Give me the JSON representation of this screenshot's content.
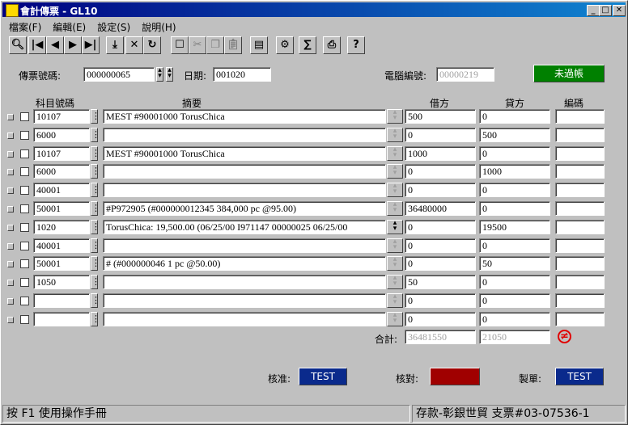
{
  "window": {
    "title": "會計傳票 - GL10"
  },
  "menu": [
    "檔案(F)",
    "編輯(E)",
    "設定(S)",
    "說明(H)"
  ],
  "toolbar": [
    {
      "icon": "search-icon",
      "glyph": "🔍︎"
    },
    {
      "icon": "first-record-icon",
      "glyph": "|◀"
    },
    {
      "icon": "prev-record-icon",
      "glyph": "◀"
    },
    {
      "icon": "next-record-icon",
      "glyph": "▶"
    },
    {
      "icon": "last-record-icon",
      "glyph": "▶|"
    },
    {
      "icon": "save-icon",
      "glyph": "⤓"
    },
    {
      "icon": "delete-icon",
      "glyph": "✕"
    },
    {
      "icon": "refresh-icon",
      "glyph": "↻"
    },
    {
      "icon": "new-icon",
      "glyph": "☐"
    },
    {
      "icon": "cut-icon",
      "glyph": "✂"
    },
    {
      "icon": "copy-icon",
      "glyph": "❐"
    },
    {
      "icon": "paste-icon",
      "glyph": "📋︎"
    },
    {
      "icon": "report-icon",
      "glyph": "▤"
    },
    {
      "icon": "options-icon",
      "glyph": "⚙"
    },
    {
      "icon": "calc-icon",
      "glyph": "∑"
    },
    {
      "icon": "print-icon",
      "glyph": "⎙"
    },
    {
      "icon": "help-icon",
      "glyph": "?"
    }
  ],
  "header": {
    "voucher_label": "傳票號碼:",
    "voucher_value": "000000065",
    "date_label": "日期:",
    "date_value": "001020",
    "computer_no_label": "電腦編號:",
    "computer_no_value": "00000219",
    "post_button": "未過帳"
  },
  "columns": {
    "account": "科目號碼",
    "summary": "摘要",
    "debit": "借方",
    "credit": "貸方",
    "code": "編碼"
  },
  "rows": [
    {
      "account": "10107",
      "summary": "MEST #90001000 TorusChica",
      "debit": "500",
      "credit": "0",
      "code": ""
    },
    {
      "account": "6000",
      "summary": "",
      "debit": "0",
      "credit": "500",
      "code": ""
    },
    {
      "account": "10107",
      "summary": "MEST #90001000 TorusChica",
      "debit": "1000",
      "credit": "0",
      "code": ""
    },
    {
      "account": "6000",
      "summary": "",
      "debit": "0",
      "credit": "1000",
      "code": ""
    },
    {
      "account": "40001",
      "summary": "",
      "debit": "0",
      "credit": "0",
      "code": ""
    },
    {
      "account": "50001",
      "summary": "#P972905 (#000000012345 384,000 pc @95.00)",
      "debit": "36480000",
      "credit": "0",
      "code": ""
    },
    {
      "account": "1020",
      "summary": "TorusChica: 19,500.00 (06/25/00 I971147 00000025 06/25/00",
      "debit": "0",
      "credit": "19500",
      "code": ""
    },
    {
      "account": "40001",
      "summary": "",
      "debit": "0",
      "credit": "0",
      "code": ""
    },
    {
      "account": "50001",
      "summary": "# (#000000046 1 pc @50.00)",
      "debit": "0",
      "credit": "50",
      "code": ""
    },
    {
      "account": "1050",
      "summary": "",
      "debit": "50",
      "credit": "0",
      "code": ""
    },
    {
      "account": "",
      "summary": "",
      "debit": "0",
      "credit": "0",
      "code": ""
    },
    {
      "account": "",
      "summary": "",
      "debit": "0",
      "credit": "0",
      "code": ""
    }
  ],
  "totals": {
    "label": "合計:",
    "debit": "36481550",
    "credit": "21050",
    "unbalanced_icon_glyph": "≠"
  },
  "footer": {
    "approve_label": "核准:",
    "approve_value": "TEST",
    "verify_label": "核對:",
    "verify_value": "",
    "prepare_label": "製單:",
    "prepare_value": "TEST"
  },
  "status": {
    "hint": "按 F1 使用操作手冊",
    "right": "存款-彰銀世貿 支票#03-07536-1"
  },
  "colors": {
    "title_start": "#000080",
    "title_end": "#1084d0",
    "post_button": "#008000",
    "user_button": "#0a2a8c",
    "verify_button": "#a00000",
    "unbalanced_icon": "#e00000"
  }
}
